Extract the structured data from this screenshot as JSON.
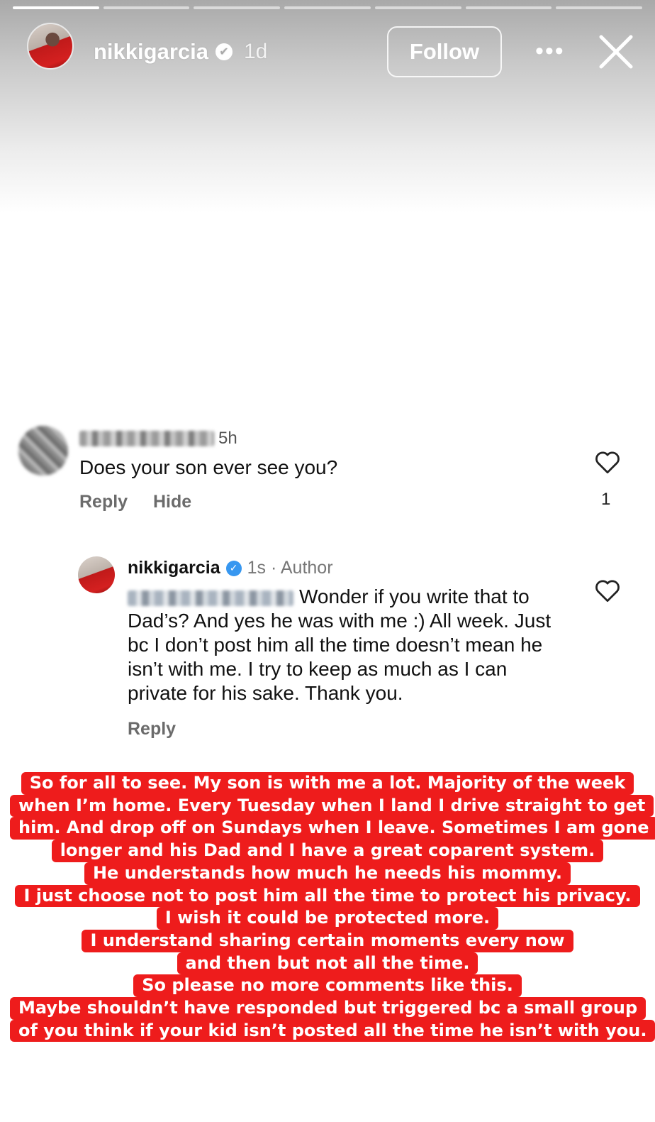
{
  "story": {
    "progress_segments": 7,
    "progress_done": 1,
    "username": "nikkigarcia",
    "time": "1d",
    "follow_label": "Follow",
    "more_icon": "more-horizontal-icon",
    "close_icon": "close-icon"
  },
  "comment": {
    "time": "5h",
    "text": "Does your son ever see you?",
    "reply_label": "Reply",
    "hide_label": "Hide",
    "like_count": "1"
  },
  "reply": {
    "username": "nikkigarcia",
    "meta": "1s · Author",
    "body": "Wonder if you write that to Dad’s? And yes he was with me :) All week. Just bc I don’t post him all the time doesn’t mean he isn’t with me. I try to keep as much as I can private for his sake. Thank you.",
    "reply_label": "Reply"
  },
  "caption": {
    "color": "#ee1c1c",
    "lines": [
      "So for all to see. My son is with me a lot. Majority of the week",
      "when I’m home. Every Tuesday when I land I drive straight to get",
      "him. And drop off on Sundays when I leave. Sometimes I am gone",
      "longer and his Dad and I have a great coparent system.",
      "He understands how much he needs his mommy.",
      "I just choose not to post him all the time to protect his privacy.",
      "I wish it could be protected more.",
      "I understand sharing certain moments every now",
      "and then but not all the time.",
      "So please no more comments like this.",
      "Maybe shouldn’t have responded but triggered bc a small group",
      "of you think if your kid isn’t posted all the time he isn’t with you."
    ]
  }
}
